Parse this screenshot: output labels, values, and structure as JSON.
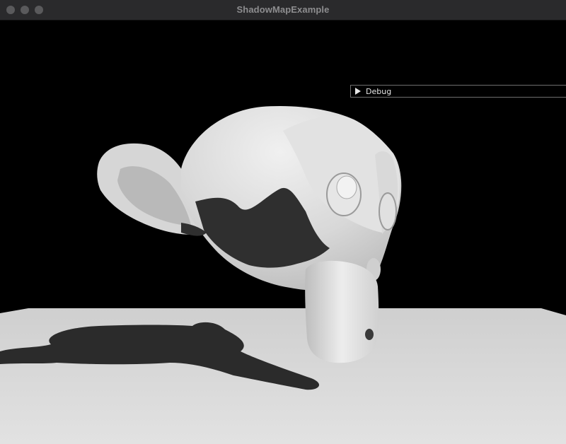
{
  "window": {
    "title": "ShadowMapExample",
    "controls": [
      "close",
      "minimize",
      "zoom"
    ]
  },
  "debug_panel": {
    "label": "Debug",
    "state": "collapsed",
    "icon": "triangle-right-icon"
  },
  "scene": {
    "object": "monkey-head-mesh",
    "surface": "ground-plane",
    "background_color": "#000000",
    "floor_color": "#d9d9d9",
    "shadow_color": "#2b2b2b"
  }
}
